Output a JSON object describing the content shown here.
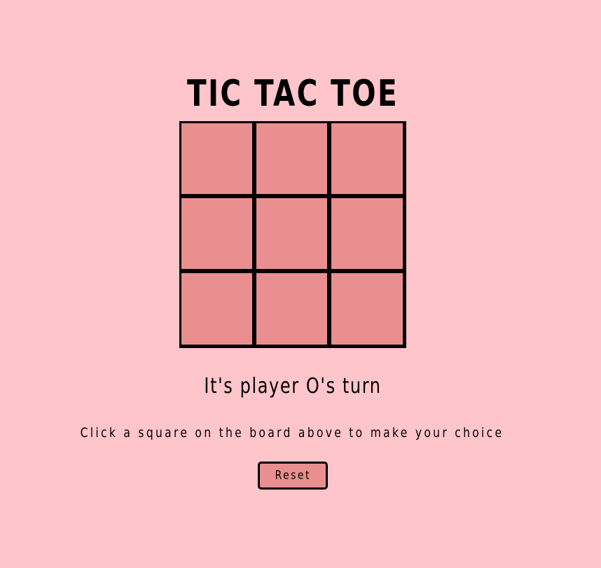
{
  "game": {
    "title": "TIC TAC TOE",
    "board": {
      "cells": [
        "",
        "",
        "",
        "",
        "",
        "",
        "",
        "",
        ""
      ]
    },
    "status": "It's player O's turn",
    "instructions": "Click a square on the board above to make your choice",
    "reset_label": "Reset"
  },
  "colors": {
    "background": "#fec5cb",
    "cell": "#e98f8f",
    "border": "#000000"
  }
}
